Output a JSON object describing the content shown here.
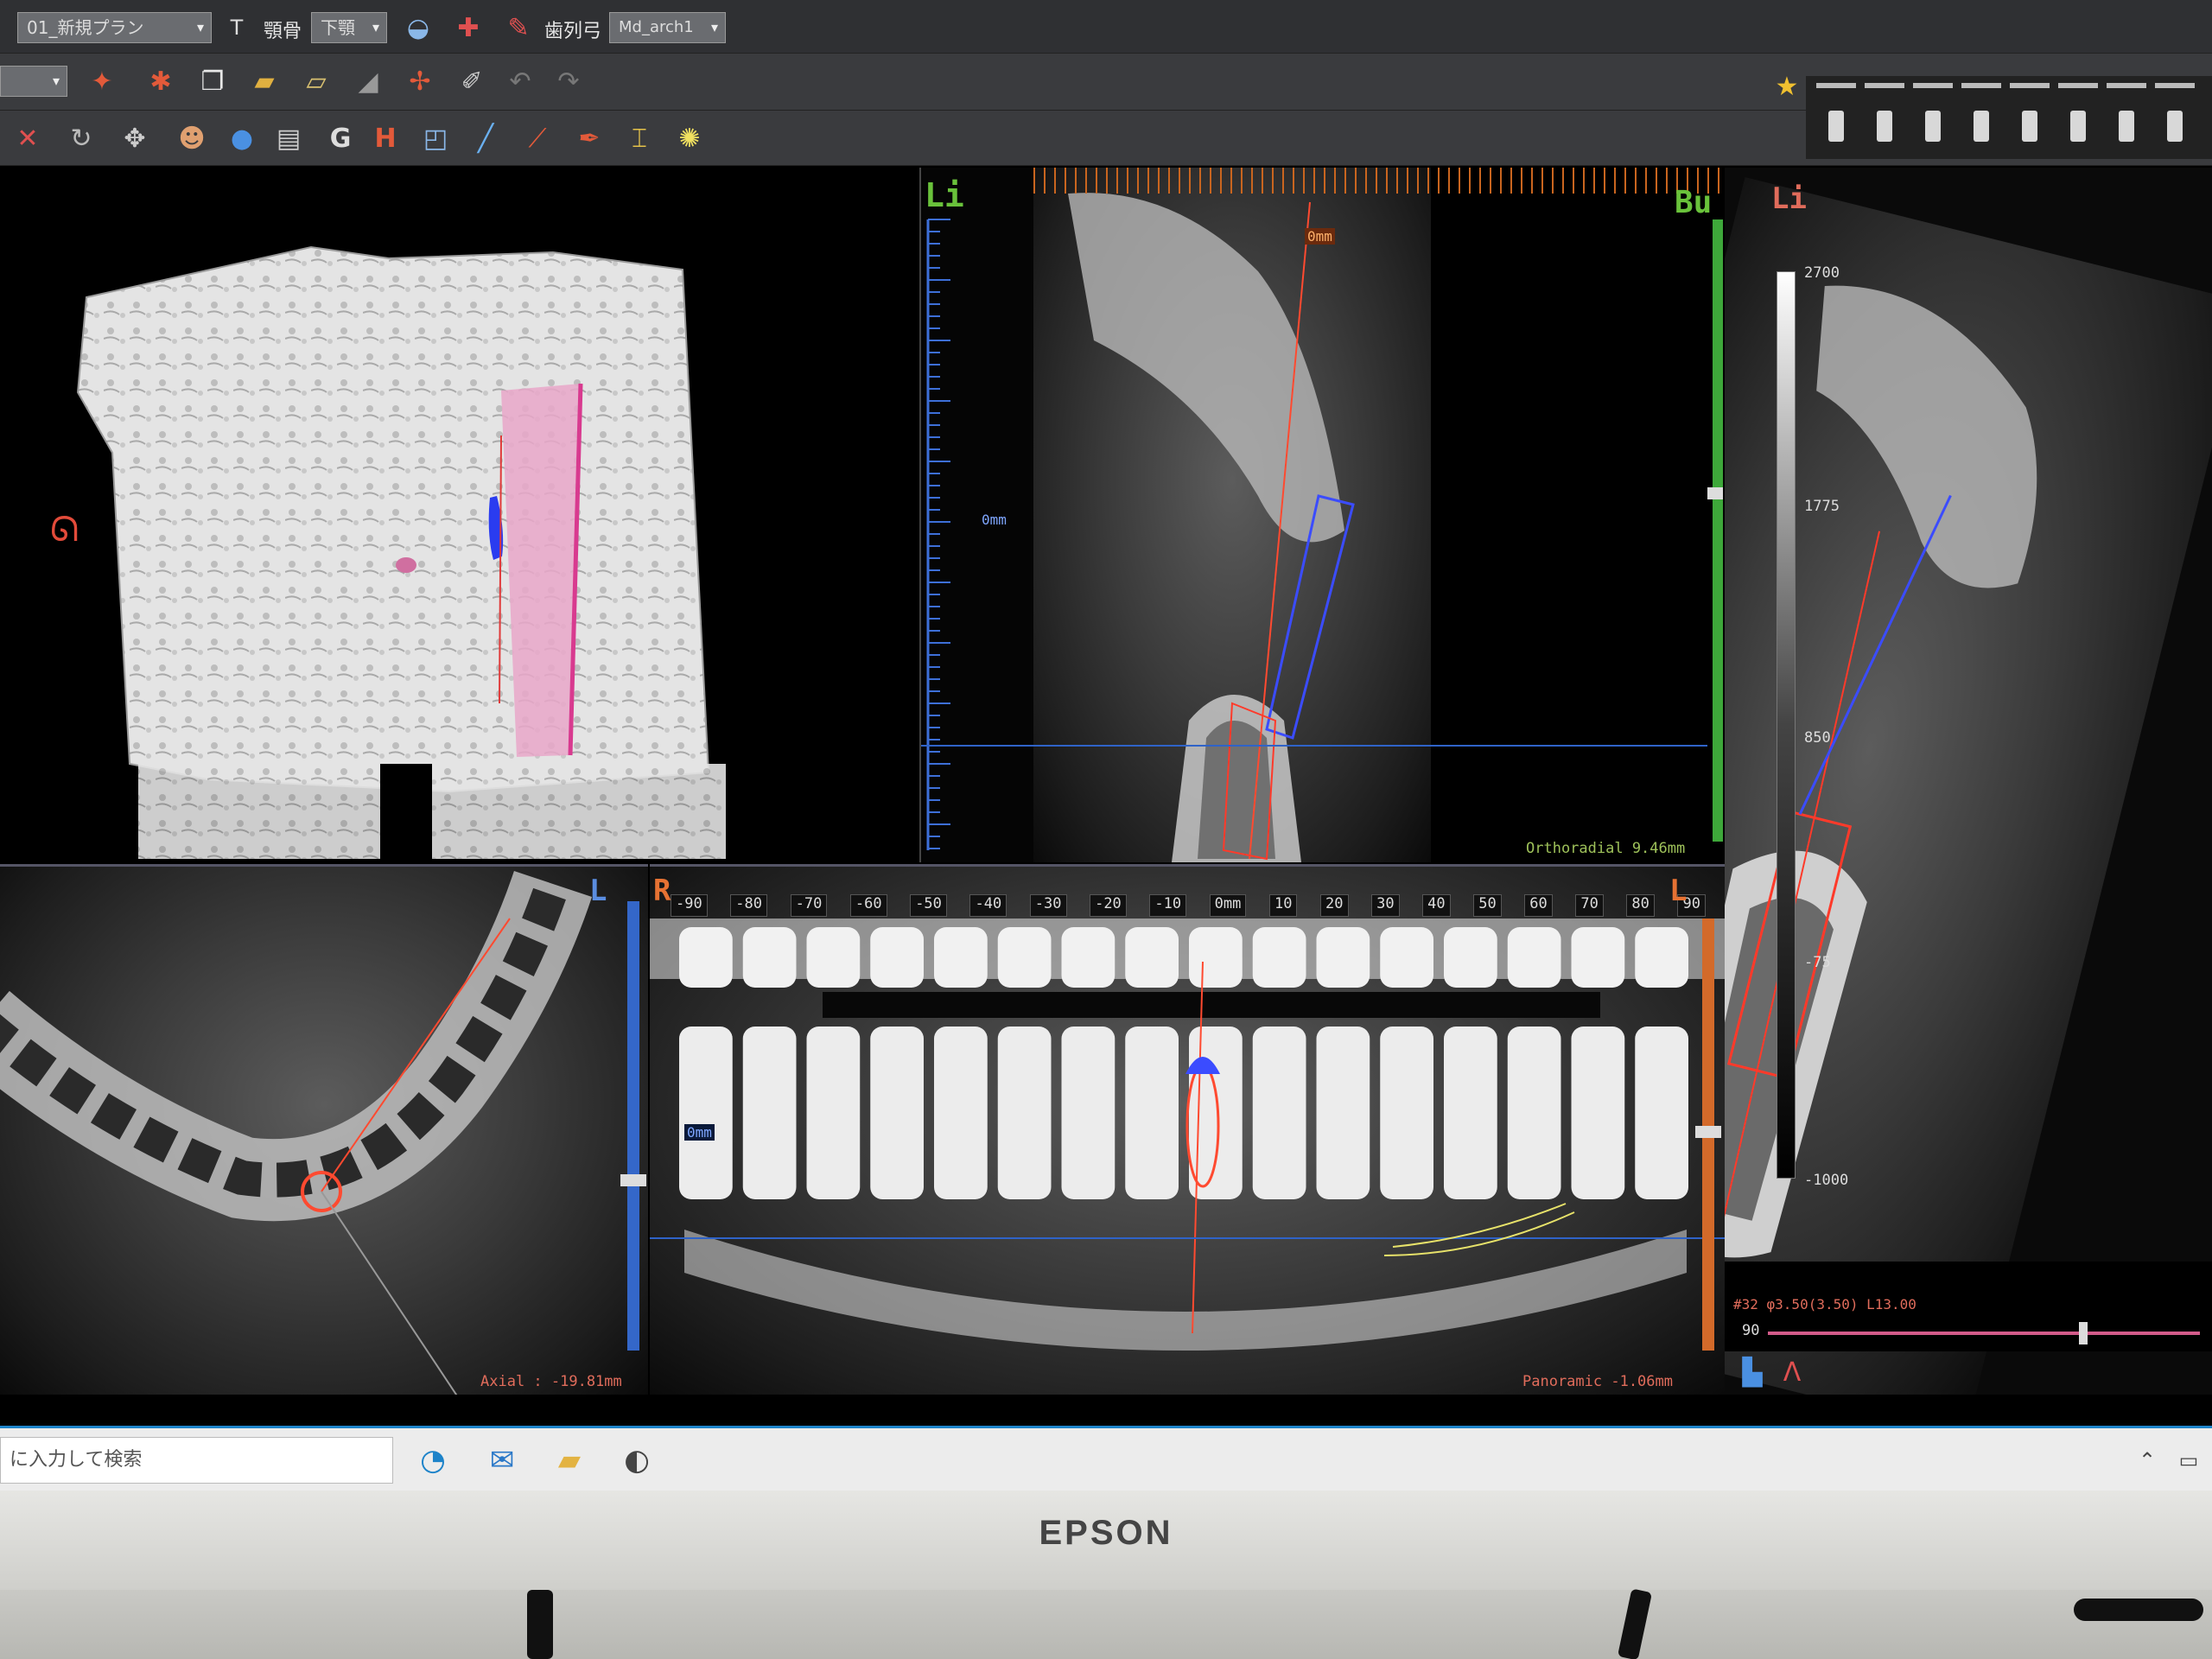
{
  "toolbar": {
    "plan_selector": "01_新規プラン",
    "jaw_label": "顎骨",
    "jaw_value": "下顎",
    "arch_label": "歯列弓",
    "arch_value": "Md_arch1"
  },
  "panels": {
    "cross_section": {
      "left_label": "Li",
      "right_label": "Bu",
      "zero_marker": "0mm",
      "status": "Orthoradial  9.46mm"
    },
    "right_view": {
      "corner_label": "Li",
      "gray_levels": [
        "2700",
        "1775",
        "850",
        "-75",
        "-1000"
      ],
      "implant_info": "#32 φ3.50(3.50) L13.00",
      "slider_value": "90"
    },
    "axial": {
      "corner_label": "L",
      "status": "Axial : -19.81mm"
    },
    "panoramic": {
      "left_label": "R",
      "right_label": "L",
      "ruler_ticks": [
        "-90",
        "-80",
        "-70",
        "-60",
        "-50",
        "-40",
        "-30",
        "-20",
        "-10",
        "0mm",
        "10",
        "20",
        "30",
        "40",
        "50",
        "60",
        "70",
        "80",
        "90"
      ],
      "zero_marker": "0mm",
      "status": "Panoramic -1.06mm"
    }
  },
  "taskbar": {
    "search_placeholder": "に入力して検索"
  },
  "monitor": {
    "brand": "EPSON"
  }
}
